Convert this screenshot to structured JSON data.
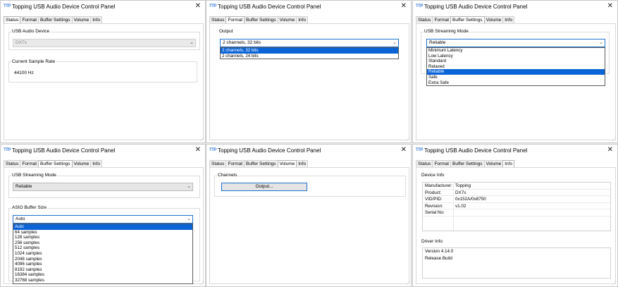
{
  "app": {
    "title": "Topping USB Audio Device Control Panel",
    "icon_glyph": "TTP",
    "close_glyph": "✕"
  },
  "tabs": [
    "Status",
    "Format",
    "Buffer Settings",
    "Volume",
    "Info"
  ],
  "status": {
    "usb_device_label": "USB Audio Device",
    "usb_device_value": "DX7s",
    "sample_rate_label": "Current Sample Rate",
    "sample_rate_value": "44100 Hz"
  },
  "format": {
    "output_label": "Output",
    "selected": "2 channels, 32 bits",
    "options": [
      "2 channels, 32 bits",
      "2 channels, 24 bits"
    ]
  },
  "buffer_mode": {
    "label": "USB Streaming Mode",
    "selected": "Reliable",
    "options": [
      "Minimum Latency",
      "Low Latency",
      "Standard",
      "Relaxed",
      "Reliable",
      "Safe",
      "Extra Safe"
    ]
  },
  "asio": {
    "mode_label": "USB Streaming Mode",
    "mode_value": "Reliable",
    "buffer_label": "ASIO Buffer Size",
    "selected": "Auto",
    "options": [
      "Auto",
      "64 samples",
      "128 samples",
      "256 samples",
      "512 samples",
      "1024 samples",
      "2048 samples",
      "4096 samples",
      "8192 samples",
      "16384 samples",
      "32768 samples"
    ]
  },
  "volume": {
    "channels_label": "Channels",
    "output_button": "Output..."
  },
  "info": {
    "device_label": "Device Info",
    "rows": [
      {
        "key": "Manufacturer:",
        "value": "Topping"
      },
      {
        "key": "Product:",
        "value": "DX7s"
      },
      {
        "key": "VID/PID:",
        "value": "0x152A/0x8750"
      },
      {
        "key": "Revision:",
        "value": "v1.02"
      },
      {
        "key": "Serial No:",
        "value": ""
      }
    ],
    "driver_label": "Driver Info",
    "driver_lines": [
      "Version 4.14.0",
      "Release Build"
    ]
  },
  "colors": {
    "selection": "#0a64d8",
    "focus_border": "#1e72d0",
    "icon": "#3b7fd6"
  }
}
